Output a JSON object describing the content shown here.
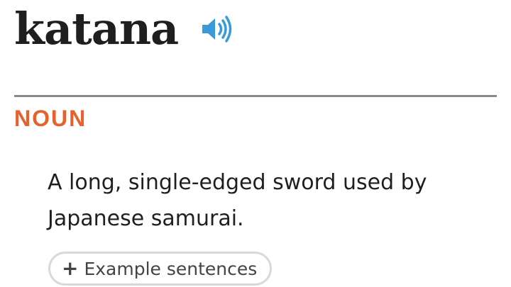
{
  "entry": {
    "headword": "katana",
    "audio_icon": "speaker-audio-icon",
    "part_of_speech": "NOUN",
    "definition": "A long, single-edged sword used by Japanese samurai.",
    "examples_toggle": {
      "icon": "plus-icon",
      "icon_glyph": "+",
      "label": "Example sentences"
    }
  },
  "colors": {
    "headword": "#1f1f1f",
    "audio_icon": "#3a9ad9",
    "part_of_speech": "#e8602c",
    "divider": "#8a8a8a",
    "toggle_border": "#d9d9d9"
  }
}
